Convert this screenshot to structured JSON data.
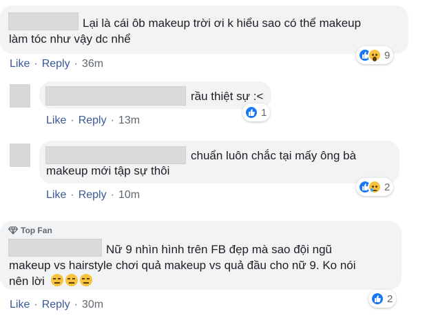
{
  "actions": {
    "like": "Like",
    "reply": "Reply"
  },
  "comments": [
    {
      "line1": "Lại là cái ôb makeup trời ơi k hiểu sao có thể makeup",
      "line2": "làm tóc như vậy dc nhể",
      "time": "36m",
      "reactions": [
        "like",
        "wow"
      ],
      "reaction_count": "9"
    },
    {
      "line1": "rầu thiệt sự :<",
      "time": "13m",
      "reactions": [
        "like"
      ],
      "reaction_count": "1"
    },
    {
      "line1": "chuẩn luôn chắc tại mấy ông bà",
      "line2": "makeup mới tập sự thôi",
      "time": "10m",
      "reactions": [
        "like",
        "sad"
      ],
      "reaction_count": "2"
    },
    {
      "badge": "Top Fan",
      "line1": "Nữ 9 nhìn hình trên FB đẹp mà sao đội ngũ",
      "line2": "makeup vs hairstyle chơi quả makeup vs quả đầu cho nữ 9. Ko nói",
      "line3": "nên lời",
      "line3_emoji": [
        "expressionless-emoji",
        "expressionless-emoji",
        "expressionless-emoji"
      ],
      "time": "30m",
      "reactions": [
        "like"
      ],
      "reaction_count": "2"
    }
  ],
  "colors": {
    "bubble": "#f2f3f5",
    "link": "#385898",
    "like": "#1877f2"
  }
}
